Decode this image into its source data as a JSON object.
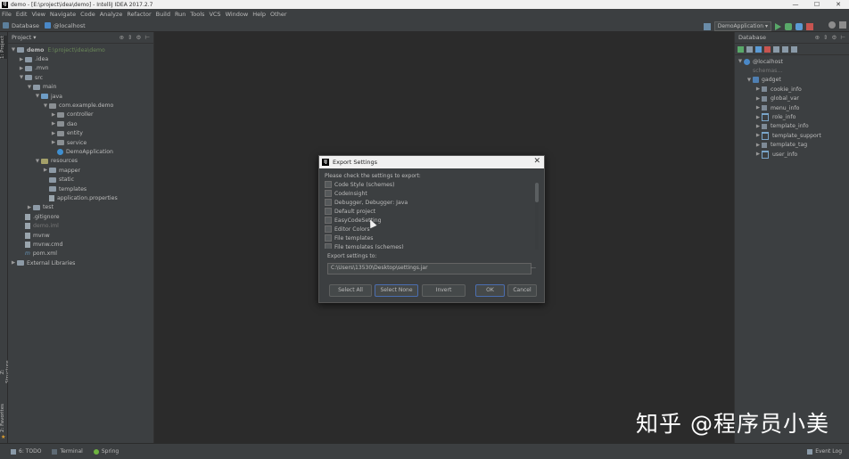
{
  "window": {
    "title": "demo - [E:\\project\\idea\\demo] - IntelliJ IDEA 2017.2.7",
    "minimize": "—",
    "maximize": "☐",
    "close": "✕"
  },
  "menu": [
    "File",
    "Edit",
    "View",
    "Navigate",
    "Code",
    "Analyze",
    "Refactor",
    "Build",
    "Run",
    "Tools",
    "VCS",
    "Window",
    "Help",
    "Other"
  ],
  "navbar": {
    "crumb1": "Database",
    "crumb2": "@localhost",
    "run_config": "DemoApplication ▾"
  },
  "left_strip": {
    "project_tab": "1: Project",
    "structure_tab": "Z: Structure",
    "favorites_tab": "2: Favorites"
  },
  "project_panel": {
    "title": "Project ▾",
    "tree": [
      {
        "label": "demo",
        "path": "E:\\project\\idea\\demo",
        "depth": 0,
        "arrow": "▼",
        "icon": "folder",
        "bold": true
      },
      {
        "label": ".idea",
        "depth": 1,
        "arrow": "▶",
        "icon": "folder"
      },
      {
        "label": ".mvn",
        "depth": 1,
        "arrow": "▶",
        "icon": "folder"
      },
      {
        "label": "src",
        "depth": 1,
        "arrow": "▼",
        "icon": "folder"
      },
      {
        "label": "main",
        "depth": 2,
        "arrow": "▼",
        "icon": "folder"
      },
      {
        "label": "java",
        "depth": 3,
        "arrow": "▼",
        "icon": "folder-src"
      },
      {
        "label": "com.example.demo",
        "depth": 4,
        "arrow": "▼",
        "icon": "package"
      },
      {
        "label": "controller",
        "depth": 5,
        "arrow": "▶",
        "icon": "package"
      },
      {
        "label": "dao",
        "depth": 5,
        "arrow": "▶",
        "icon": "package"
      },
      {
        "label": "entity",
        "depth": 5,
        "arrow": "▶",
        "icon": "package"
      },
      {
        "label": "service",
        "depth": 5,
        "arrow": "▶",
        "icon": "package"
      },
      {
        "label": "DemoApplication",
        "depth": 5,
        "arrow": "",
        "icon": "class"
      },
      {
        "label": "resources",
        "depth": 3,
        "arrow": "▼",
        "icon": "folder-res"
      },
      {
        "label": "mapper",
        "depth": 4,
        "arrow": "▶",
        "icon": "folder"
      },
      {
        "label": "static",
        "depth": 4,
        "arrow": "",
        "icon": "folder"
      },
      {
        "label": "templates",
        "depth": 4,
        "arrow": "",
        "icon": "folder"
      },
      {
        "label": "application.properties",
        "depth": 4,
        "arrow": "",
        "icon": "file"
      },
      {
        "label": "test",
        "depth": 2,
        "arrow": "▶",
        "icon": "folder"
      },
      {
        "label": ".gitignore",
        "depth": 1,
        "arrow": "",
        "icon": "file"
      },
      {
        "label": "demo.iml",
        "depth": 1,
        "arrow": "",
        "icon": "file",
        "dim": true
      },
      {
        "label": "mvnw",
        "depth": 1,
        "arrow": "",
        "icon": "file"
      },
      {
        "label": "mvnw.cmd",
        "depth": 1,
        "arrow": "",
        "icon": "file"
      },
      {
        "label": "pom.xml",
        "depth": 1,
        "arrow": "",
        "icon": "maven"
      },
      {
        "label": "External Libraries",
        "depth": 0,
        "arrow": "▶",
        "icon": "folder"
      }
    ]
  },
  "db_panel": {
    "title": "Database",
    "tree": [
      {
        "label": "@localhost",
        "depth": 0,
        "arrow": "▼",
        "icon": "db"
      },
      {
        "label": "schemas...",
        "depth": 1,
        "arrow": "",
        "icon": "none",
        "dim": true
      },
      {
        "label": "gadget",
        "depth": 1,
        "arrow": "▼",
        "icon": "schema"
      },
      {
        "label": "cookie_info",
        "depth": 2,
        "arrow": "▶",
        "icon": "table"
      },
      {
        "label": "global_var",
        "depth": 2,
        "arrow": "▶",
        "icon": "table"
      },
      {
        "label": "menu_info",
        "depth": 2,
        "arrow": "▶",
        "icon": "table"
      },
      {
        "label": "role_info",
        "depth": 2,
        "arrow": "▶",
        "icon": "view"
      },
      {
        "label": "template_info",
        "depth": 2,
        "arrow": "▶",
        "icon": "table"
      },
      {
        "label": "template_support",
        "depth": 2,
        "arrow": "▶",
        "icon": "view"
      },
      {
        "label": "template_tag",
        "depth": 2,
        "arrow": "▶",
        "icon": "table"
      },
      {
        "label": "user_info",
        "depth": 2,
        "arrow": "▶",
        "icon": "view"
      }
    ]
  },
  "dialog": {
    "title": "Export Settings",
    "close": "✕",
    "prompt": "Please check the settings to export:",
    "items": [
      "Code Style (schemes)",
      "CodeInsight",
      "Debugger, Debugger: Java",
      "Default project",
      "EasyCodeSetting",
      "Editor Colors",
      "File templates",
      "File templates (schemes)"
    ],
    "path_label": "Export settings to:",
    "path_value": "C:\\Users\\13530\\Desktop\\settings.jar",
    "browse": "...",
    "buttons": {
      "select_all": "Select All",
      "select_none": "Select None",
      "invert": "Invert",
      "ok": "OK",
      "cancel": "Cancel"
    }
  },
  "statusbar": {
    "todo": "6: TODO",
    "terminal": "Terminal",
    "spring": "Spring",
    "event_log": "Event Log"
  },
  "watermark": "知乎 @程序员小美"
}
